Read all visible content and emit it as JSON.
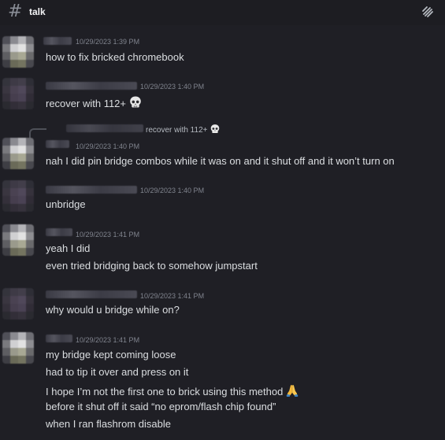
{
  "channel": {
    "hash": "#",
    "name": "talk"
  },
  "messages": [
    {
      "timestamp": "10/29/2023 1:39 PM",
      "lines": [
        "how to fix bricked chromebook"
      ]
    },
    {
      "timestamp": "10/29/2023 1:40 PM",
      "lines": [
        "recover with 112+"
      ]
    },
    {
      "reply_preview": "recover with 112+",
      "timestamp": "10/29/2023 1:40 PM",
      "lines": [
        "nah I did pin bridge combos while it was on and it shut off and it won’t turn on"
      ]
    },
    {
      "timestamp": "10/29/2023 1:40 PM",
      "lines": [
        "unbridge"
      ]
    },
    {
      "timestamp": "10/29/2023 1:41 PM",
      "lines": [
        "yeah I did",
        "even tried bridging back to somehow jumpstart"
      ]
    },
    {
      "timestamp": "10/29/2023 1:41 PM",
      "lines": [
        "why would u bridge while on?"
      ]
    },
    {
      "timestamp": "10/29/2023 1:41 PM",
      "lines": [
        "my bridge kept coming loose",
        "had to tip it over and press on it",
        "I hope I’m not the first one to brick using this method",
        "before it shut off it said “no eprom/flash chip found”",
        "when I ran flashrom disable"
      ]
    }
  ],
  "icons": {
    "threads": "threads-icon",
    "skull": "skull-emoji",
    "pray": "folded-hands-emoji"
  }
}
